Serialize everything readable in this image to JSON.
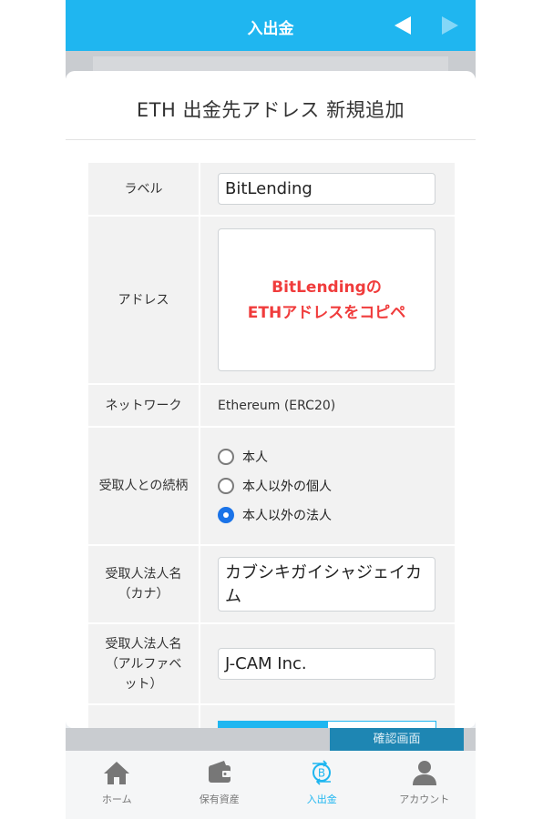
{
  "header": {
    "title": "入出金"
  },
  "colors": {
    "accent": "#1fb6f0",
    "overlay_text": "#f03c3c",
    "radio_selected": "#1a73e8"
  },
  "modal": {
    "title": "ETH 出金先アドレス 新規追加",
    "fields": {
      "label": {
        "label": "ラベル",
        "value": "BitLending"
      },
      "address": {
        "label": "アドレス",
        "overlay_line1": "BitLendingの",
        "overlay_line2": "ETHアドレスをコピペ"
      },
      "network": {
        "label": "ネットワーク",
        "value": "Ethereum (ERC20)"
      },
      "relationship": {
        "label": "受取人との続柄",
        "options": [
          "本人",
          "本人以外の個人",
          "本人以外の法人"
        ],
        "selected": "本人以外の法人"
      },
      "corp_name_kana": {
        "label_line1": "受取人法人名",
        "label_line2": "（カナ）",
        "value": "カブシキガイシャジェイカム"
      },
      "corp_name_alpha": {
        "label_line1": "受取人法人名",
        "label_line2": "（アルファベ",
        "label_line3": "ット）",
        "value": "J-CAM Inc."
      }
    }
  },
  "behind": {
    "confirm_label": "確認画面"
  },
  "nav": {
    "items": [
      {
        "label": "ホーム",
        "icon": "home-icon"
      },
      {
        "label": "保有資産",
        "icon": "wallet-icon"
      },
      {
        "label": "入出金",
        "icon": "bitcoin-transfer-icon"
      },
      {
        "label": "アカウント",
        "icon": "account-icon"
      }
    ],
    "active": "入出金"
  }
}
